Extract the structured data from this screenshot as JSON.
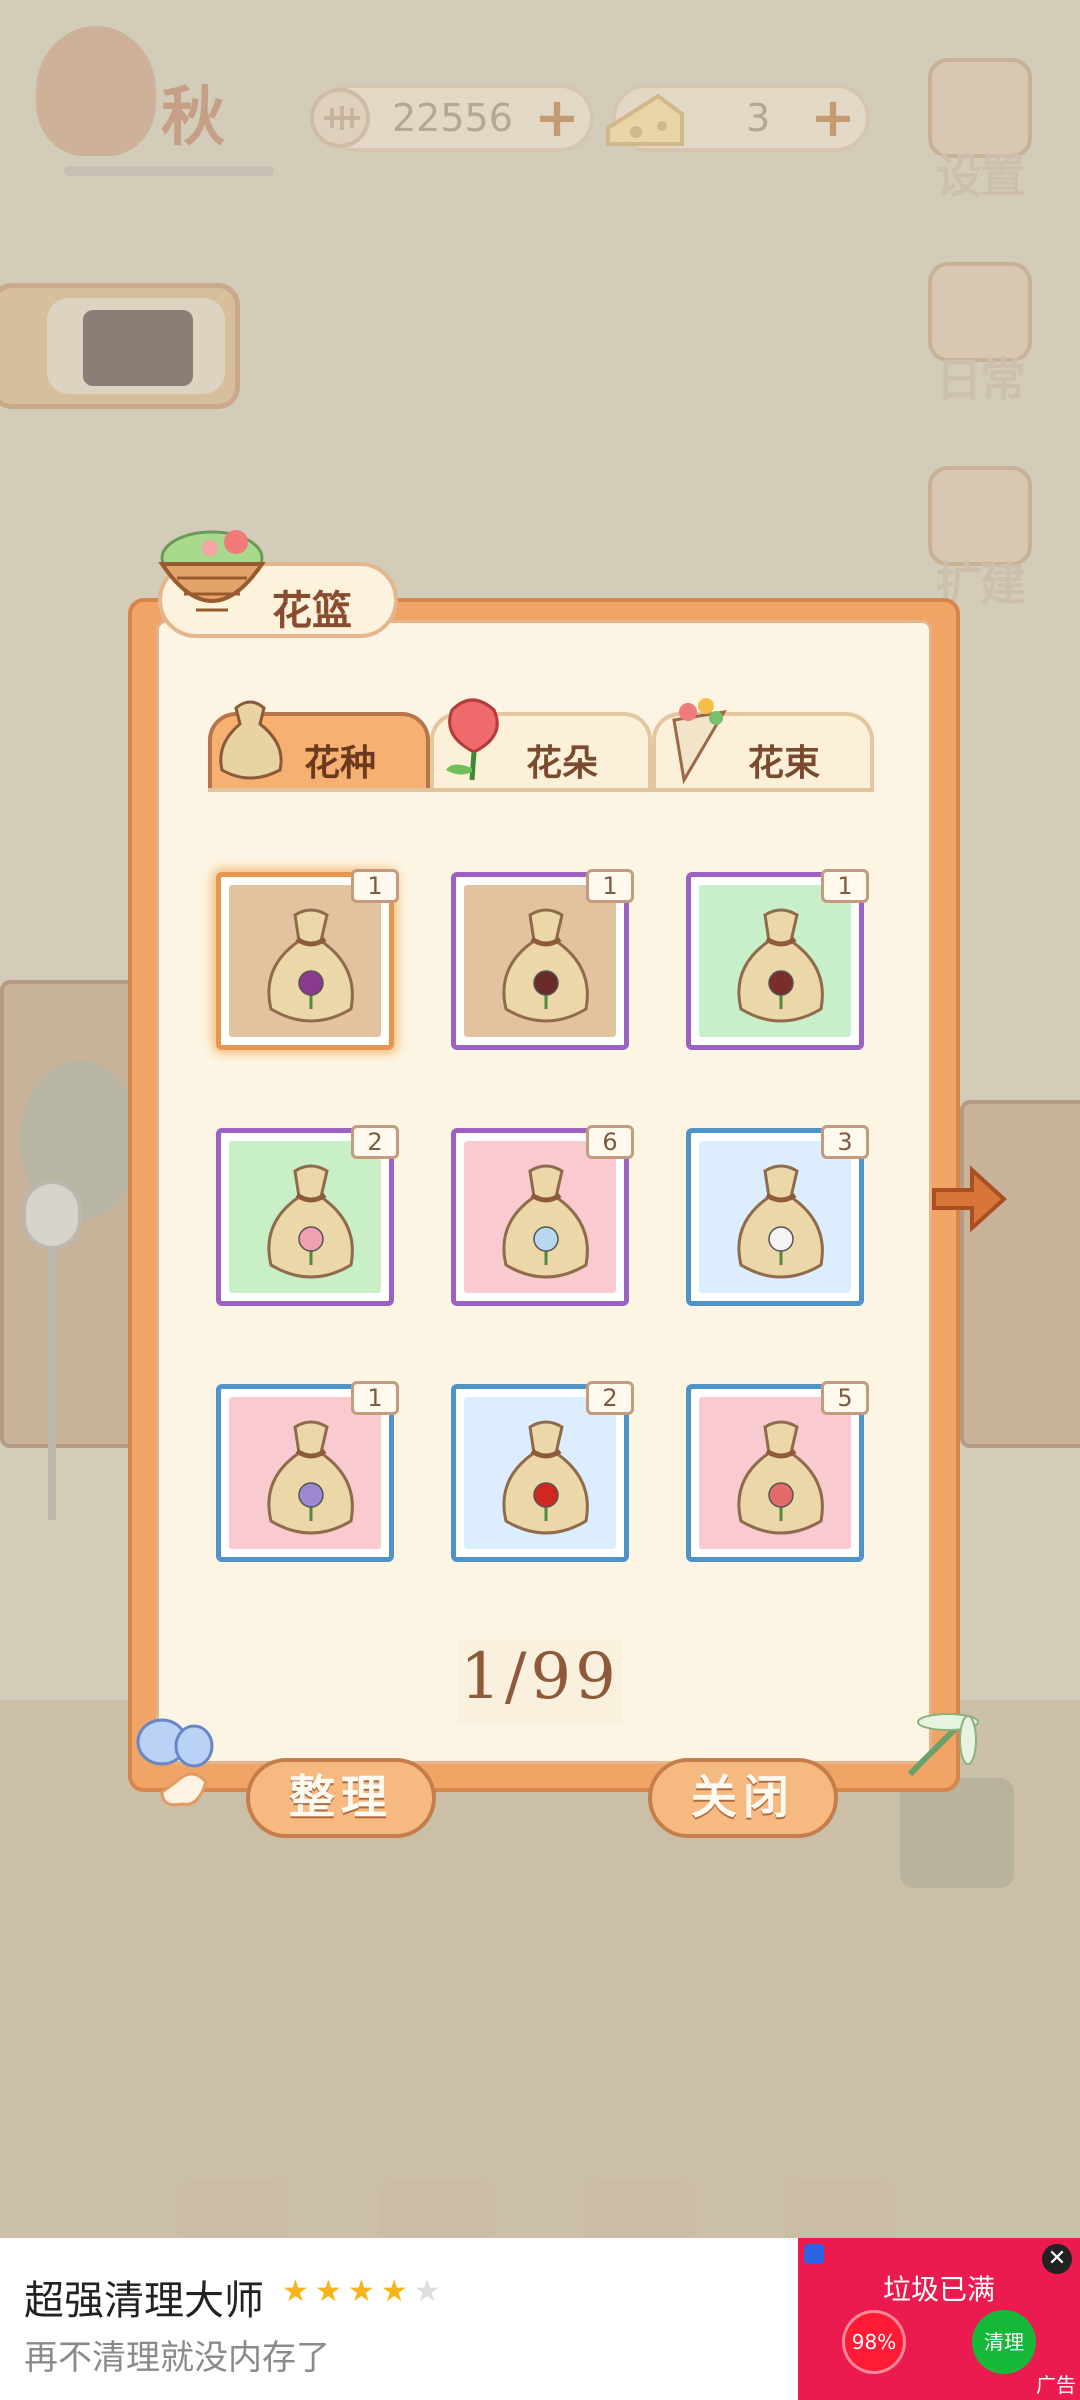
{
  "hud": {
    "season_label": "秋",
    "fish_currency": "22556",
    "cheese_currency": "3",
    "plus_symbol": "+"
  },
  "side_menu": {
    "settings": "设置",
    "daily": "日常",
    "expand": "扩建"
  },
  "panel": {
    "title": "花篮",
    "tabs": [
      {
        "label": "花种",
        "active": true
      },
      {
        "label": "花朵",
        "active": false
      },
      {
        "label": "花束",
        "active": false
      }
    ],
    "items": [
      {
        "count": "1",
        "border": "#e7954f",
        "fill": "#e3c39f",
        "flower": "#8a3a8c"
      },
      {
        "count": "1",
        "border": "#9b62c4",
        "fill": "#e3c39f",
        "flower": "#6b2a2a"
      },
      {
        "count": "1",
        "border": "#9b62c4",
        "fill": "#c7efc9",
        "flower": "#7a2d2a"
      },
      {
        "count": "2",
        "border": "#9b62c4",
        "fill": "#c9efc7",
        "flower": "#f0a0b2"
      },
      {
        "count": "6",
        "border": "#9b62c4",
        "fill": "#f9cbd0",
        "flower": "#b8d8f0"
      },
      {
        "count": "3",
        "border": "#4f93c9",
        "fill": "#dceefd",
        "flower": "#f4f4f4"
      },
      {
        "count": "1",
        "border": "#4f93c9",
        "fill": "#f9cbd0",
        "flower": "#9b88d0"
      },
      {
        "count": "2",
        "border": "#4f93c9",
        "fill": "#dceefd",
        "flower": "#d0281f"
      },
      {
        "count": "5",
        "border": "#4f93c9",
        "fill": "#f9cbd0",
        "flower": "#e26a6a"
      }
    ],
    "page": "1/99",
    "sort_button": "整理",
    "close_button": "关闭"
  },
  "ad": {
    "title": "超强清理大师",
    "subtitle": "再不清理就没内存了",
    "rating": 4,
    "rating_max": 5,
    "star_char": "★",
    "right_title": "垃圾已满",
    "percent": "98%",
    "clean_button": "清理",
    "tag": "广告",
    "close_char": "✕"
  }
}
